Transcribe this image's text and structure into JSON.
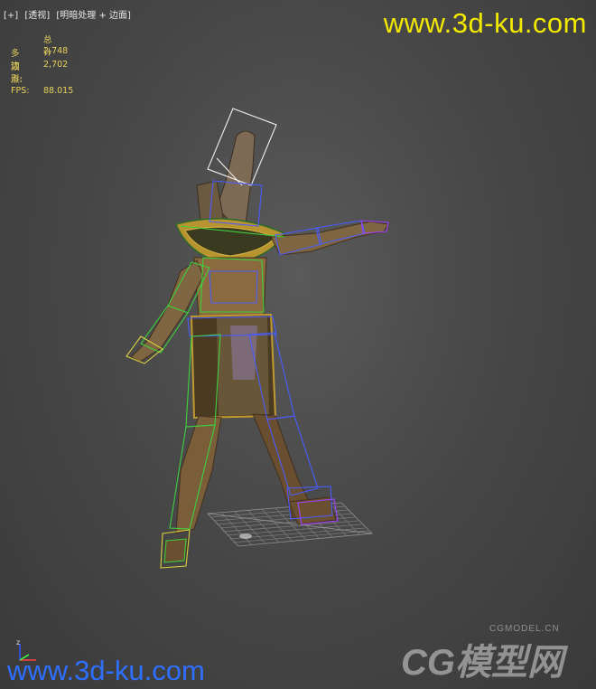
{
  "viewport": {
    "label_items": [
      "[+]",
      "[透视]",
      "[明暗处理 + 边面]"
    ]
  },
  "stats": {
    "header": "总计",
    "polys_label": "多边形:",
    "polys_value": "2,748",
    "verts_label": "顶点:",
    "verts_value": "2,702",
    "fps_label": "FPS:",
    "fps_value": "88.015"
  },
  "watermark": {
    "top": "www.3d-ku.com",
    "bottom": "www.3d-ku.com",
    "logo_small": "CGMODEL.CN",
    "logo_big": "CG模型网"
  },
  "axis": {
    "z_label": "z"
  },
  "colors": {
    "stats_text": "#e7d25a",
    "watermark_top": "#f3e800",
    "watermark_bottom": "#2f6fff",
    "bone_green": "#3fcf3f",
    "bone_blue": "#4a5cff",
    "bone_purple": "#a040ff",
    "bone_white": "#f0f0f0",
    "bone_yellow": "#d8d040",
    "skin": "#8a6a3e"
  },
  "icons": [
    "axis-gizmo-icon",
    "cg-model-logo"
  ]
}
